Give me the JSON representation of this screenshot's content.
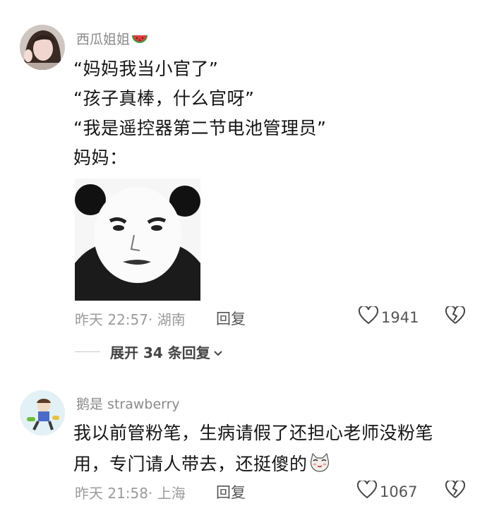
{
  "comments": [
    {
      "username": "西瓜姐姐",
      "username_emoji": "watermelon-icon",
      "lines": [
        "“妈妈我当小官了”",
        "“孩子真棒，什么官呀”",
        "“我是遥控器第二节电池管理员”",
        "妈妈："
      ],
      "image": "panda-face-meme",
      "time": "昨天 22:57",
      "location": "· 湖南",
      "reply_label": "回复",
      "likes": "1941",
      "expand_label": "展开 34 条回复"
    },
    {
      "username": "鹅是 strawberry",
      "lines": [
        "我以前管粉笔，生病请假了还担心老师没粉笔",
        "用，专门请人带去，还挺傻的"
      ],
      "trailing_emoji": "cat-face-icon",
      "time": "昨天 21:58",
      "location": "· 上海",
      "reply_label": "回复",
      "likes": "1067"
    }
  ],
  "colors": {
    "username": "#8a8a8a",
    "meta": "#9b9b9b",
    "text": "#151515",
    "accent_watermelon": "#e23b3b"
  }
}
